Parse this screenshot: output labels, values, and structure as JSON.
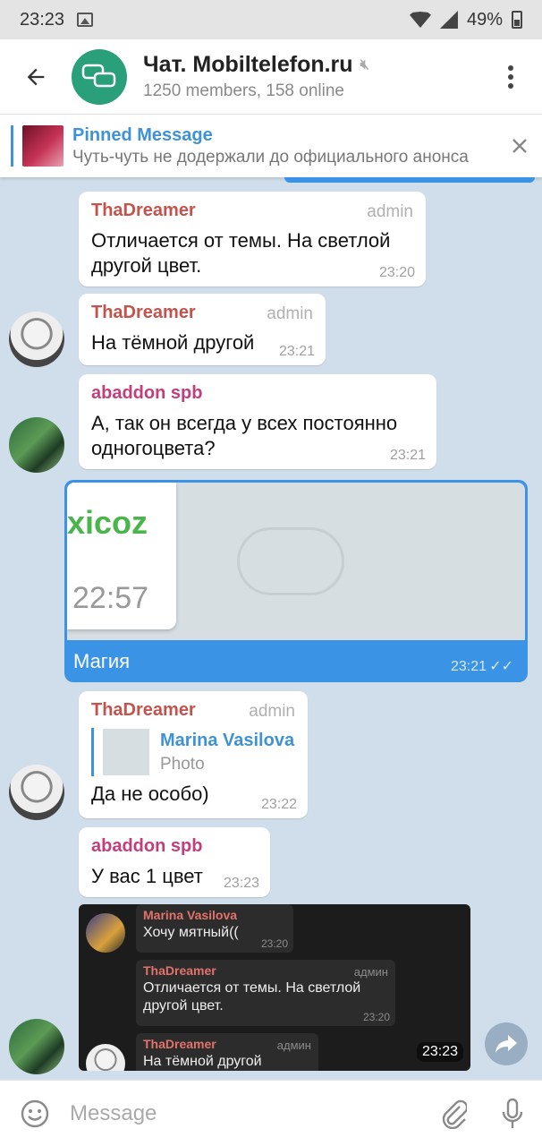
{
  "status_bar": {
    "time": "23:23",
    "battery": "49%",
    "icons": [
      "gallery-icon",
      "wifi-icon",
      "signal-icon",
      "battery-icon"
    ]
  },
  "header": {
    "title": "Чат. Mobiltelefon.ru",
    "subtitle": "1250 members, 158 online",
    "muted_icon": "muted-icon"
  },
  "pinned": {
    "title": "Pinned Message",
    "text": "Чуть-чуть не додержали до официального анонса"
  },
  "messages": [
    {
      "author": "ThaDreamer",
      "badge": "admin",
      "text": "Отличается от темы. На светлой другой цвет.",
      "time": "23:20"
    },
    {
      "author": "ThaDreamer",
      "badge": "admin",
      "text": "На тёмной другой",
      "time": "23:21"
    },
    {
      "author": "abaddon spb",
      "text": "А, так он всегда у всех постоянно одногоцвета?",
      "time": "23:21"
    },
    {
      "type": "photo",
      "photo_brand": "xicoz",
      "photo_clock": "22:57",
      "caption": "Магия",
      "time": "23:21",
      "status": "read"
    },
    {
      "author": "ThaDreamer",
      "badge": "admin",
      "reply_to": {
        "author": "Marina Vasilova",
        "type": "Photo"
      },
      "text": "Да не особо)",
      "time": "23:22"
    },
    {
      "author": "abaddon spb",
      "text": "У вас 1 цвет",
      "time": "23:23"
    },
    {
      "type": "screenshot",
      "time": "23:23",
      "inner": [
        {
          "author": "Marina Vasilova",
          "text": "Хочу мятный((",
          "time": "23:20"
        },
        {
          "author": "ThaDreamer",
          "badge": "админ",
          "text": "Отличается от темы. На светлой другой цвет.",
          "time": "23:20"
        },
        {
          "author": "ThaDreamer",
          "badge": "админ",
          "text": "На тёмной другой"
        }
      ]
    }
  ],
  "input": {
    "placeholder": "Message"
  },
  "colors": {
    "accent": "#3e92d6",
    "chat_bg": "#cfdeea",
    "outgoing": "#3a93e4",
    "thadreamer": "#c3534d",
    "abaddon": "#c23f7c"
  }
}
